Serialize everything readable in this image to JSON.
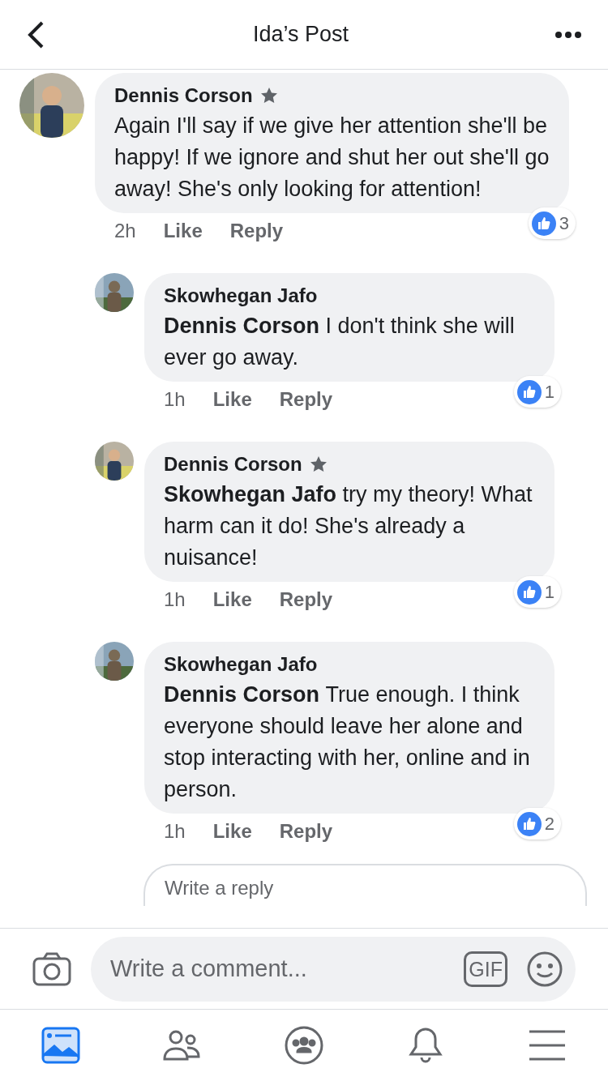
{
  "header": {
    "title": "Ida’s Post"
  },
  "comments": [
    {
      "kind": "comment",
      "author": "Dennis Corson",
      "badge": true,
      "text": "Again I'll say if we give her attention she'll be happy! If we ignore and shut her out she'll go away! She's only looking for attention!",
      "time": "2h",
      "like": "Like",
      "reply": "Reply",
      "reactions": "3"
    },
    {
      "kind": "reply",
      "author": "Skowhegan Jafo",
      "badge": false,
      "mention": "Dennis Corson",
      "text": "I don't think she will ever go away.",
      "time": "1h",
      "like": "Like",
      "reply": "Reply",
      "reactions": "1"
    },
    {
      "kind": "reply",
      "author": "Dennis Corson",
      "badge": true,
      "mention": "Skowhegan Jafo",
      "text": "try my theory! What harm can it do! She's already a nuisance!",
      "time": "1h",
      "like": "Like",
      "reply": "Reply",
      "reactions": "1"
    },
    {
      "kind": "reply",
      "author": "Skowhegan Jafo",
      "badge": false,
      "mention": "Dennis Corson",
      "text": "True enough.  I think everyone should leave her alone and stop interacting with her, online and in person.",
      "time": "1h",
      "like": "Like",
      "reply": "Reply",
      "reactions": "2"
    }
  ],
  "reply_field": {
    "placeholder": "Write a reply"
  },
  "composer": {
    "placeholder": "Write a comment...",
    "gif": "GIF"
  },
  "tabs": [
    {
      "kind": "feed",
      "selected": true
    },
    {
      "kind": "friends",
      "selected": false
    },
    {
      "kind": "groups",
      "selected": false
    },
    {
      "kind": "notifications",
      "selected": false
    },
    {
      "kind": "menu",
      "selected": false
    }
  ]
}
